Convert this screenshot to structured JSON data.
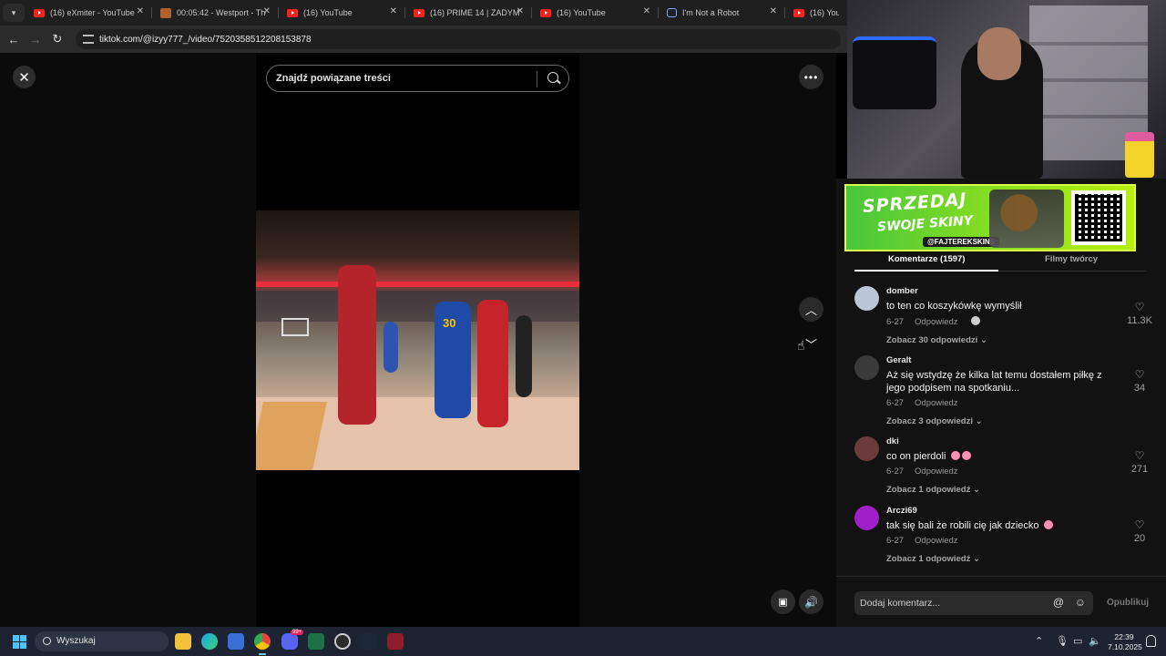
{
  "browser": {
    "tabs": [
      {
        "title": "(16) eXmiter - YouTube",
        "icon": "youtube-icon"
      },
      {
        "title": "00:05:42 - Westport - The",
        "icon": "westport-icon"
      },
      {
        "title": "(16) YouTube",
        "icon": "youtube-icon"
      },
      {
        "title": "(16) PRIME 14 | ZADYMA",
        "icon": "youtube-icon"
      },
      {
        "title": "(16) YouTube",
        "icon": "youtube-icon"
      },
      {
        "title": "I'm Not a Robot",
        "icon": "robot-icon"
      },
      {
        "title": "(16) YouTube",
        "icon": "youtube-icon"
      }
    ],
    "url": "tiktok.com/@izyy777_/video/7520358512208153878"
  },
  "tiktok": {
    "search_placeholder": "Znajdź powiązane treści",
    "video_jersey_number": "30",
    "comments_tab": "Komentarze (1597)",
    "creator_videos_tab": "Filmy twórcy",
    "comments": [
      {
        "user": "domber",
        "text": "to ten co koszykówkę wymyślił",
        "date": "6-27",
        "reply": "Odpowiedz",
        "view_replies": "Zobacz 30 odpowiedzi",
        "likes": "11.3K",
        "avatar_color": "#b9c6d6"
      },
      {
        "user": "Geralt",
        "text": "Aż się wstydzę że kilka lat temu dostałem piłkę z jego podpisem na spotkaniu...",
        "date": "6-27",
        "reply": "Odpowiedz",
        "view_replies": "Zobacz 3 odpowiedzi",
        "likes": "34",
        "avatar_color": "#3a3a3a"
      },
      {
        "user": "dki",
        "text": "co on pierdoli",
        "date": "6-27",
        "reply": "Odpowiedz",
        "view_replies": "Zobacz 1 odpowiedź",
        "likes": "271",
        "avatar_color": "#6b3a3a"
      },
      {
        "user": "Arczi69",
        "text": "tak się bali że robili cię jak dziecko",
        "date": "6-27",
        "reply": "Odpowiedz",
        "view_replies": "Zobacz 1 odpowiedź",
        "likes": "20",
        "avatar_color": "#a01fc9"
      }
    ],
    "add_comment_placeholder": "Dodaj komentarz...",
    "publish_label": "Opublikuj"
  },
  "banner": {
    "line1": "SPRZEDAJ",
    "line2": "SWOJE SKINY",
    "handle": "@FAJTEREKSKINS"
  },
  "taskbar": {
    "search_label": "Wyszukaj",
    "time": "22:39",
    "date": "7.10.2025",
    "notification_badge": "99+"
  },
  "colors": {
    "accent_blue": "#4cc2ff",
    "youtube_red": "#ff1f1f",
    "banner_green": "#8be01e"
  }
}
